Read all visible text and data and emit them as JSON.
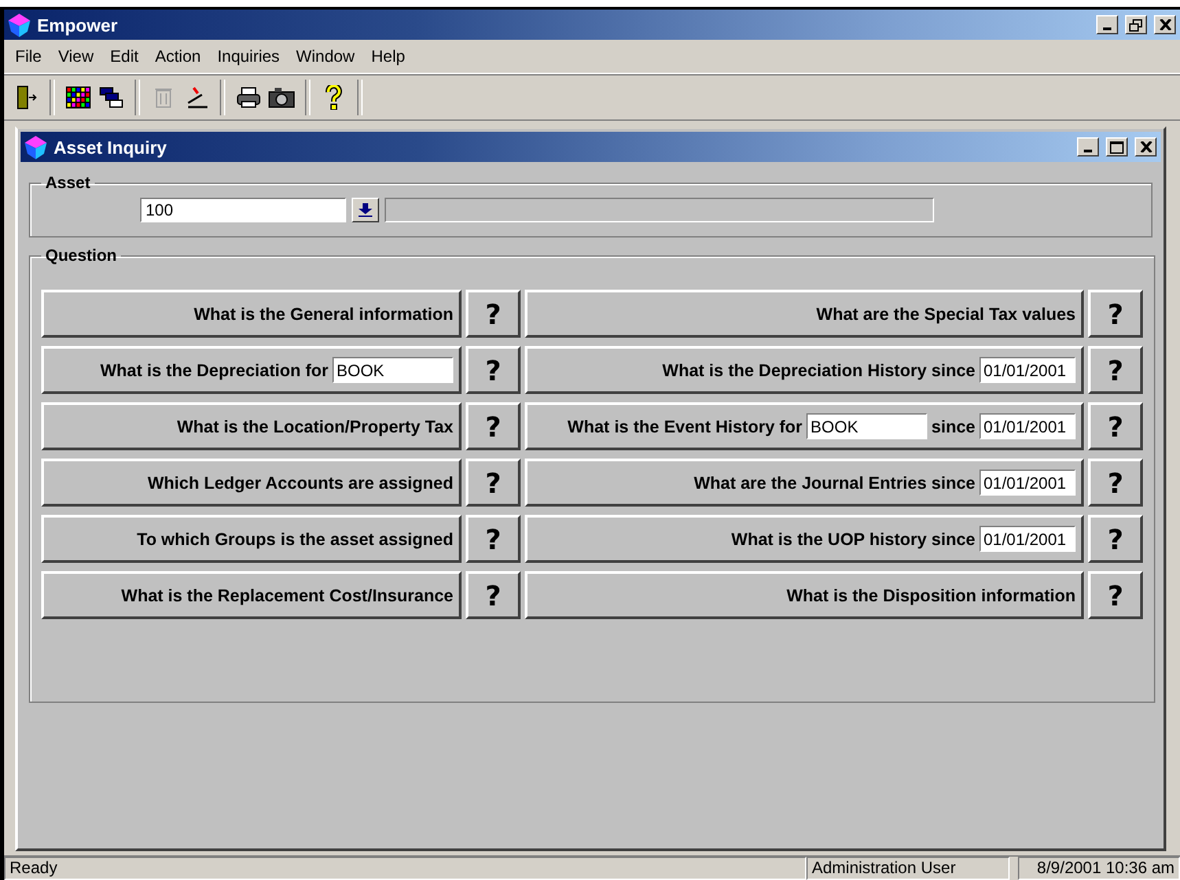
{
  "window": {
    "title": "Empower"
  },
  "menu": [
    "File",
    "View",
    "Edit",
    "Action",
    "Inquiries",
    "Window",
    "Help"
  ],
  "child": {
    "title": "Asset Inquiry"
  },
  "asset": {
    "legend": "Asset",
    "value": "100"
  },
  "question_group": {
    "legend": "Question"
  },
  "questions": [
    {
      "parts": [
        {
          "kind": "text",
          "text": "What is the General information"
        }
      ],
      "help": "?"
    },
    {
      "parts": [
        {
          "kind": "text",
          "text": "What are the Special Tax values"
        }
      ],
      "help": "?"
    },
    {
      "parts": [
        {
          "kind": "text",
          "text": "What is the Depreciation for"
        },
        {
          "kind": "field",
          "value": "BOOK"
        }
      ],
      "help": "?"
    },
    {
      "parts": [
        {
          "kind": "text",
          "text": "What is the Depreciation History since"
        },
        {
          "kind": "date",
          "value": "01/01/2001"
        }
      ],
      "help": "?"
    },
    {
      "parts": [
        {
          "kind": "text",
          "text": "What is the Location/Property Tax"
        }
      ],
      "help": "?"
    },
    {
      "parts": [
        {
          "kind": "text",
          "text": "What is the Event History for"
        },
        {
          "kind": "field",
          "value": "BOOK"
        },
        {
          "kind": "text",
          "text": "since"
        },
        {
          "kind": "date",
          "value": "01/01/2001"
        }
      ],
      "help": "?"
    },
    {
      "parts": [
        {
          "kind": "text",
          "text": "Which Ledger Accounts are assigned"
        }
      ],
      "help": "?"
    },
    {
      "parts": [
        {
          "kind": "text",
          "text": "What are the Journal Entries since"
        },
        {
          "kind": "date",
          "value": "01/01/2001"
        }
      ],
      "help": "?"
    },
    {
      "parts": [
        {
          "kind": "text",
          "text": "To which Groups is the asset assigned"
        }
      ],
      "help": "?"
    },
    {
      "parts": [
        {
          "kind": "text",
          "text": "What is the UOP history since"
        },
        {
          "kind": "date",
          "value": "01/01/2001"
        }
      ],
      "help": "?"
    },
    {
      "parts": [
        {
          "kind": "text",
          "text": "What is the Replacement Cost/Insurance"
        }
      ],
      "help": "?"
    },
    {
      "parts": [
        {
          "kind": "text",
          "text": "What is the Disposition information"
        }
      ],
      "help": "?"
    }
  ],
  "status_bar": {
    "message": "Ready",
    "user": "Administration User",
    "datetime": "8/9/2001 10:36 am"
  }
}
